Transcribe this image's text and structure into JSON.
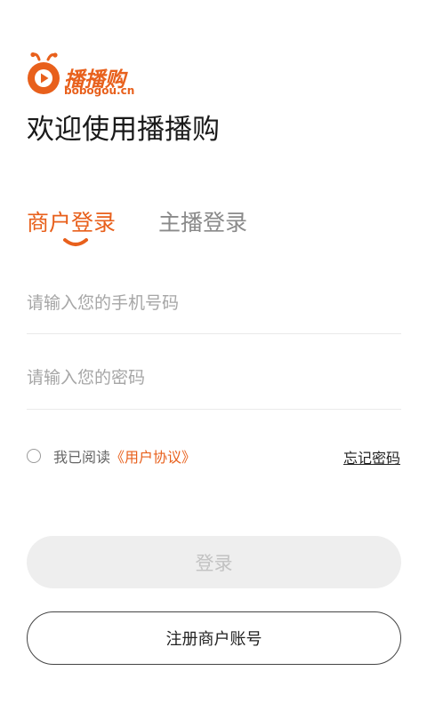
{
  "brand": {
    "name": "播播购",
    "domain": "bobogou.cn",
    "color": "#e8601c"
  },
  "welcome": "欢迎使用播播购",
  "tabs": [
    {
      "label": "商户登录",
      "active": true
    },
    {
      "label": "主播登录",
      "active": false
    }
  ],
  "form": {
    "phone_placeholder": "请输入您的手机号码",
    "password_placeholder": "请输入您的密码"
  },
  "agreement": {
    "text": "我已阅读",
    "link": "《用户协议》",
    "checked": false
  },
  "forgot_password": "忘记密码",
  "login_button": "登录",
  "register_button": "注册商户账号",
  "icons": {
    "logo": "play-bug-logo-icon",
    "radio": "radio-unchecked-icon",
    "tab_indicator": "smile-underline-icon"
  }
}
